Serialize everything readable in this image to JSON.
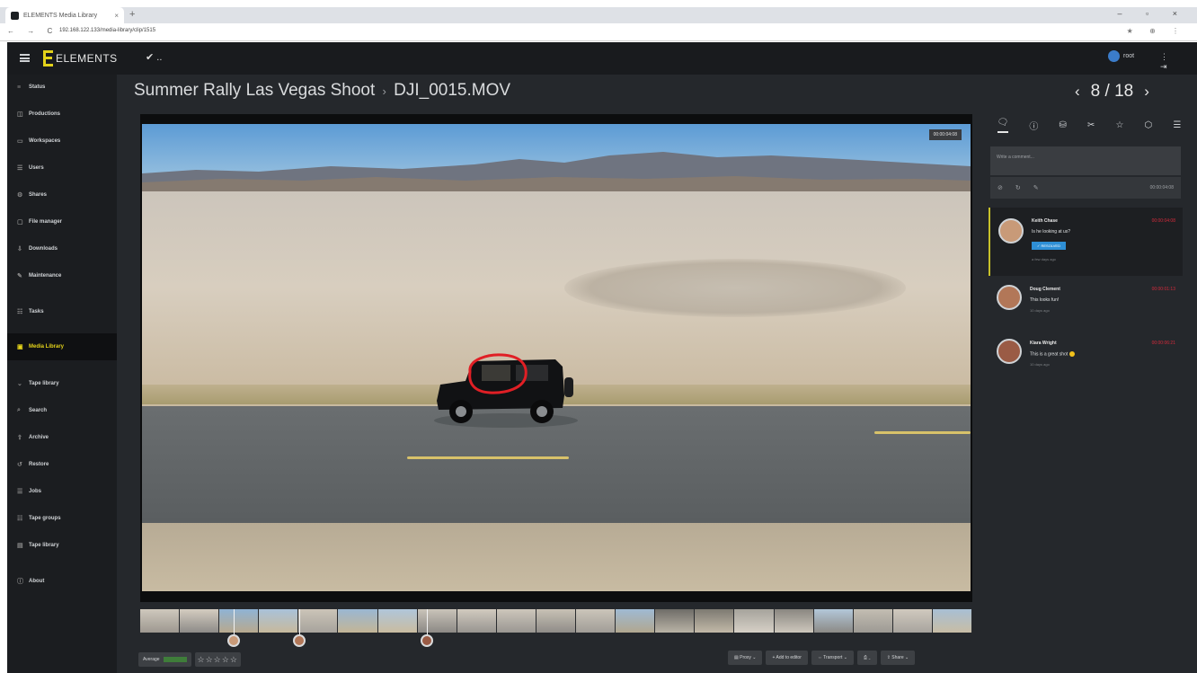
{
  "browser": {
    "tab_title": "ELEMENTS Media Library",
    "tab_close": "×",
    "new_tab": "+",
    "window_controls": "– ▫ ×",
    "nav_buttons": "← → C",
    "url": "192.168.122.133/media-library/clip/1515",
    "extensions": "★ ⊕ ⋮"
  },
  "app": {
    "logo_text": "ELEMENTS",
    "top_action": "✔ ..",
    "user_name": "root",
    "top_icons": "⋮ ⇥"
  },
  "sidebar": {
    "items": [
      {
        "icon": "≡",
        "label": "Status"
      },
      {
        "icon": "◫",
        "label": "Productions"
      },
      {
        "icon": "▭",
        "label": "Workspaces"
      },
      {
        "icon": "☰",
        "label": "Users"
      },
      {
        "icon": "⚙",
        "label": "Shares"
      },
      {
        "icon": "▢",
        "label": "File manager"
      },
      {
        "icon": "⇩",
        "label": "Downloads"
      },
      {
        "icon": "✎",
        "label": "Maintenance"
      },
      {
        "icon": "☷",
        "label": "Tasks"
      },
      {
        "icon": "▣",
        "label": "Media Library"
      },
      {
        "icon": "⌄",
        "label": "Tape library"
      },
      {
        "icon": "⌕",
        "label": "Search"
      },
      {
        "icon": "⇧",
        "label": "Archive"
      },
      {
        "icon": "↺",
        "label": "Restore"
      },
      {
        "icon": "☰",
        "label": "Jobs"
      },
      {
        "icon": "☷",
        "label": "Tape groups"
      },
      {
        "icon": "▤",
        "label": "Tape library"
      },
      {
        "icon": "ⓘ",
        "label": "About"
      }
    ]
  },
  "main": {
    "breadcrumb_parent": "Summer Rally Las Vegas Shoot",
    "breadcrumb_sep": "›",
    "breadcrumb_current": "DJI_0015.MOV",
    "pager_prev": "‹",
    "pager_text": "8 / 18",
    "pager_next": "›",
    "timecode": "00:00:04:08"
  },
  "bottom": {
    "average_label": "Average",
    "stars": "☆☆☆☆☆",
    "buttons": [
      "▤ Proxy ⌄",
      "+ Add to editor",
      "⇔ Transport ⌄",
      "⎙ ⌄",
      "⇪ Share ⌄"
    ]
  },
  "panel": {
    "tabs": [
      "🗨",
      "ⓘ",
      "⛁",
      "✂",
      "☆",
      "⬡",
      "☰"
    ],
    "comment_placeholder": "Write a comment...",
    "comment_tools": [
      "⊘",
      "↻",
      "✎"
    ],
    "comment_timecode": "00:00:04:08",
    "comments": [
      {
        "name": "Keith Chase",
        "text": "Is he looking at us?",
        "tag": "✓ RESOLVED",
        "time": "a few days ago",
        "timecode": "00:00:04:08",
        "avatar_color": "#c89a78"
      },
      {
        "name": "Doug Clement",
        "text": "This looks fun!",
        "tag": "",
        "time": "10 days ago",
        "timecode": "00:00:01:13",
        "avatar_color": "#b27758"
      },
      {
        "name": "Kiara Wright",
        "text": "This is a great shot",
        "tag": "",
        "time": "10 days ago",
        "timecode": "00:00:06:21",
        "avatar_color": "#9a5b45"
      }
    ]
  },
  "colors": {
    "accent": "#e3d21a",
    "timecode_red": "#d42a3b",
    "resolved_blue": "#2e8fd6",
    "annotation_red": "#e01f25"
  }
}
